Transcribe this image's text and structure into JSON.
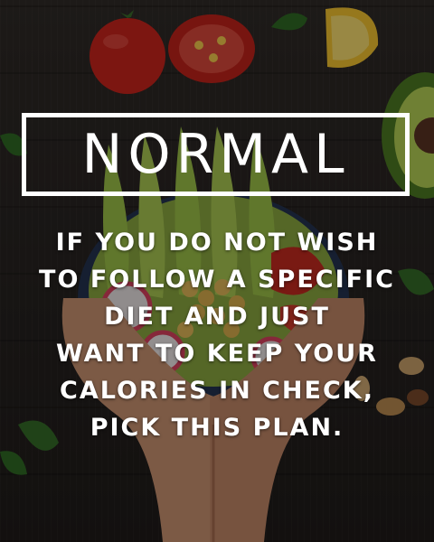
{
  "title": "NORMAL",
  "description_lines": [
    "IF YOU DO NOT WISH",
    "TO FOLLOW A SPECIFIC",
    "DIET AND JUST",
    "WANT TO KEEP YOUR",
    "CALORIES IN CHECK,",
    "PICK THIS PLAN."
  ],
  "colors": {
    "text": "#ffffff",
    "background": "#2a2523"
  }
}
